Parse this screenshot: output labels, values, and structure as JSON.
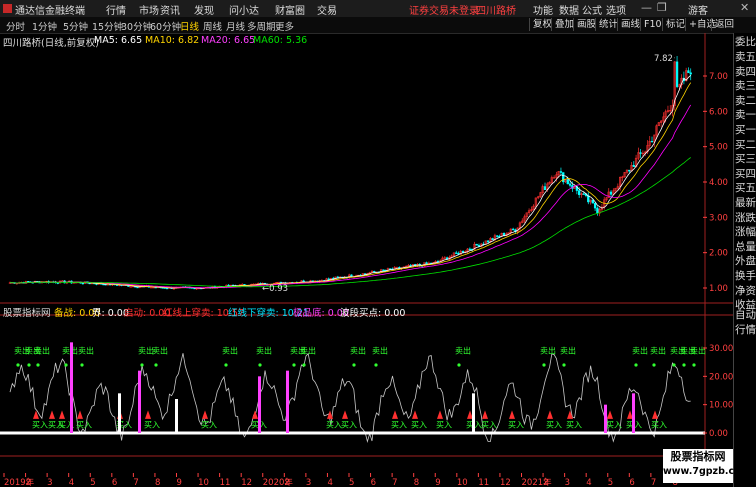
{
  "topbar": {
    "app_name": "通达信金融终端",
    "menus": [
      "行情",
      "市场",
      "资讯",
      "发现",
      "问小达",
      "财富圈",
      "交易"
    ],
    "warning": "证券交易未登录",
    "stock_name": "四川路桥",
    "right_menus": [
      "功能",
      "数据",
      "公式",
      "选项"
    ],
    "user": "游客",
    "minimize": "—",
    "restore": "❐",
    "close": "✕"
  },
  "periodbar": {
    "periods": [
      "分时",
      "1分钟",
      "5分钟",
      "15分钟",
      "30分钟",
      "60分钟",
      "日线",
      "周线",
      "月线",
      "多周期",
      "更多"
    ],
    "active_period": "日线",
    "tools": [
      "复权",
      "叠加",
      "画股",
      "统计",
      "画线",
      "F10",
      "标记",
      "+自选",
      "返回"
    ]
  },
  "main_chart": {
    "title": "四川路桥(日线,前复权)",
    "ma5_label": "MA5: 6.65",
    "ma10_label": "MA10: 6.82",
    "ma20_label": "MA20: 6.65",
    "ma60_label": "MA60: 5.36",
    "y_ticks": [
      "7.00",
      "6.00",
      "5.00",
      "4.00",
      "3.00",
      "2.00",
      "1.00"
    ],
    "high_label": "7.82",
    "low_label": "0.93",
    "colors": {
      "ma5": "#ffffff",
      "ma10": "#ffd400",
      "ma20": "#ff00ff",
      "ma60": "#00e000",
      "up": "#ff3030",
      "down": "#00ffff"
    }
  },
  "sub_chart": {
    "title": "股票指标网",
    "lines": [
      {
        "label": "备战: 0.00",
        "color": "#ffd400"
      },
      {
        "label": "界: 0.00",
        "color": "#ffffff"
      },
      {
        "label": "启动: 0.00",
        "color": "#ff3030"
      },
      {
        "label": "红线上穿卖: 10.57",
        "color": "#ff3030"
      },
      {
        "label": "红线下穿卖: 10.21",
        "color": "#00e5ff"
      },
      {
        "label": "极品底: 0.00",
        "color": "#ff40ff"
      },
      {
        "label": "波段买点: 0.00",
        "color": "#ffffff"
      }
    ],
    "y_ticks": [
      "30.00",
      "20.00",
      "10.00",
      "0.00"
    ],
    "sell_label": "卖出",
    "buy_label": "买入"
  },
  "x_axis": {
    "labels": [
      "2019年",
      "2",
      "3",
      "4",
      "5",
      "6",
      "7",
      "8",
      "9",
      "10",
      "11",
      "12",
      "2020年",
      "2",
      "3",
      "4",
      "5",
      "6",
      "7",
      "8",
      "9",
      "10",
      "11",
      "12",
      "2021年",
      "2",
      "3",
      "4",
      "5",
      "6",
      "7",
      "8"
    ]
  },
  "right_panel": {
    "items": [
      "委比",
      "卖五",
      "卖四",
      "卖三",
      "卖二",
      "卖一",
      "买一",
      "买二",
      "买三",
      "买四",
      "买五",
      "最新",
      "涨跌",
      "涨幅",
      "总量",
      "外盘",
      "换手",
      "净资",
      "收益"
    ],
    "bottom_items": [
      "自动",
      "行情"
    ]
  },
  "watermark": {
    "line1": "股票指标网",
    "line2": "www.7gpzb.com"
  }
}
